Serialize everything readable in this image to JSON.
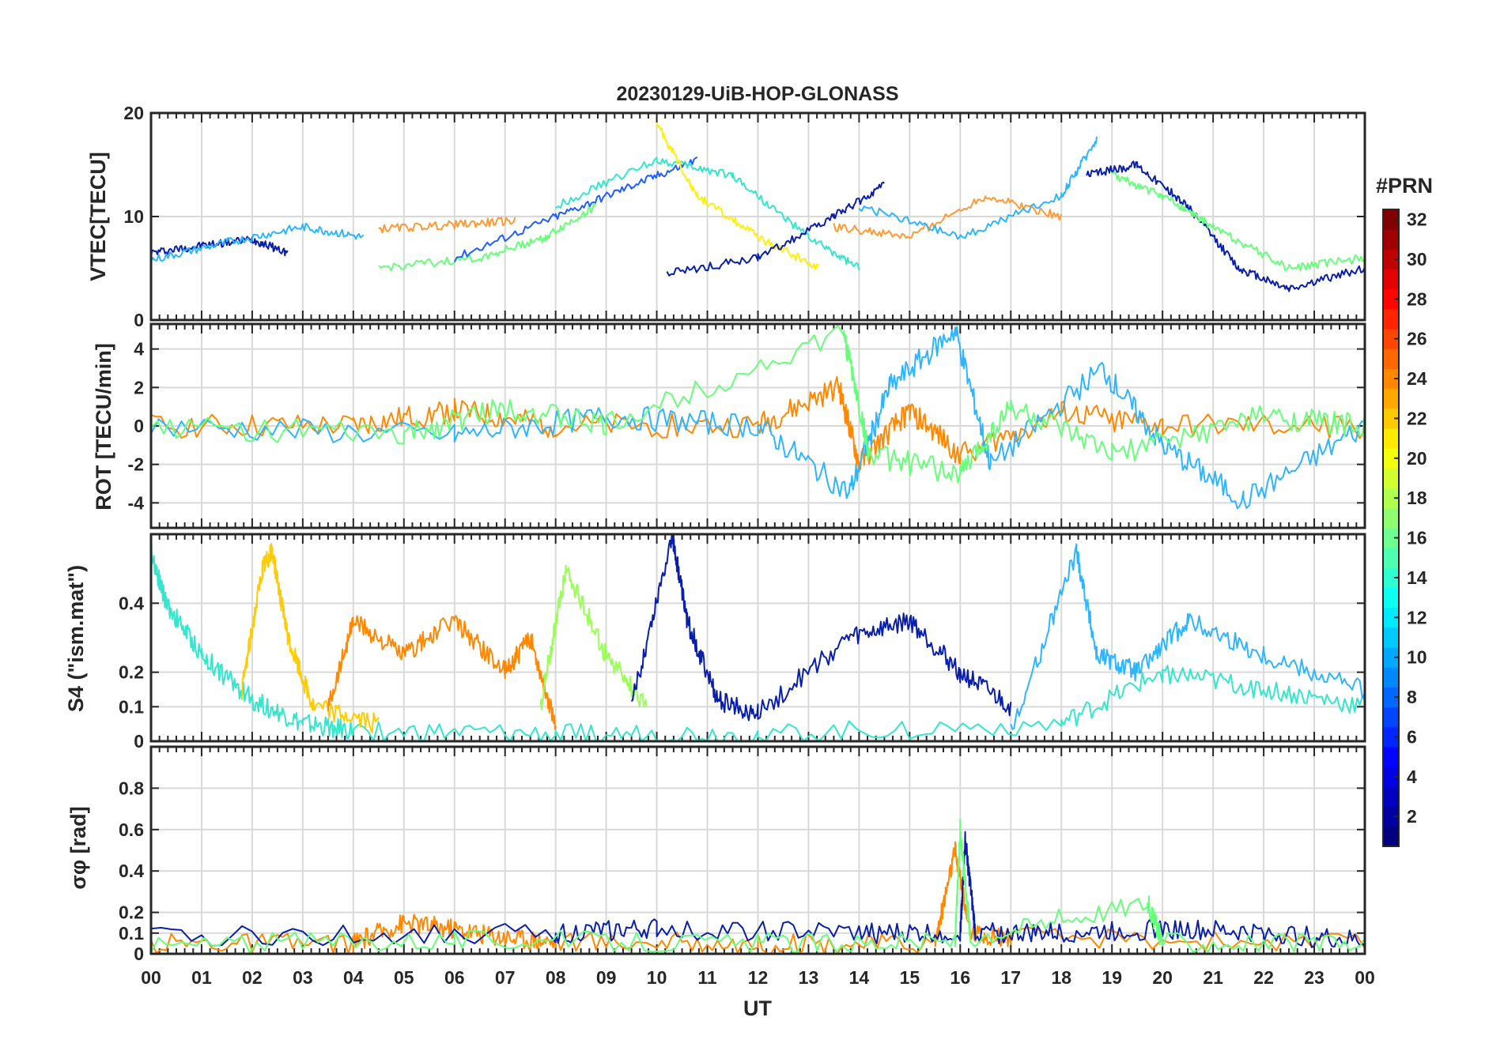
{
  "chart_data": [
    {
      "type": "line",
      "panel": "vtec",
      "title": "20230129-UiB-HOP-GLONASS",
      "ylabel": "VTEC[TECU]",
      "ylim": [
        0,
        20
      ],
      "yticks": [
        0,
        10,
        20
      ],
      "xlim": [
        0,
        24
      ],
      "grid": true,
      "series": [
        {
          "color": "#0a1fa8",
          "x": [
            0,
            1,
            2,
            2.7
          ],
          "y": [
            6.5,
            7.2,
            7.8,
            6.5
          ]
        },
        {
          "color": "#2db5ff",
          "x": [
            0,
            1.5,
            3,
            4.2
          ],
          "y": [
            5.8,
            7.5,
            9,
            8
          ]
        },
        {
          "color": "#ff9933",
          "x": [
            4.5,
            6,
            7.2
          ],
          "y": [
            8.8,
            9.2,
            9.6
          ]
        },
        {
          "color": "#66ff7a",
          "x": [
            4.5,
            6.5,
            7.8,
            8.8
          ],
          "y": [
            5,
            6,
            8,
            11
          ]
        },
        {
          "color": "#1f5fff",
          "x": [
            6,
            8,
            9.5,
            10.8
          ],
          "y": [
            6,
            10,
            13,
            15.5
          ]
        },
        {
          "color": "#33e6cc",
          "x": [
            8,
            10,
            11.5,
            13,
            14
          ],
          "y": [
            11,
            15.5,
            14,
            8,
            5
          ]
        },
        {
          "color": "#ffee11",
          "x": [
            10,
            10.8,
            12,
            13.2
          ],
          "y": [
            19,
            12,
            8,
            5
          ]
        },
        {
          "color": "#0a1fa8",
          "x": [
            10.2,
            12,
            13.5,
            14.5
          ],
          "y": [
            4.5,
            6,
            10,
            13
          ]
        },
        {
          "color": "#ff9933",
          "x": [
            13.5,
            15,
            16.5,
            18
          ],
          "y": [
            9,
            8,
            12,
            10
          ]
        },
        {
          "color": "#2db5ff",
          "x": [
            14,
            16,
            18,
            18.7
          ],
          "y": [
            11,
            8,
            12,
            17.5
          ]
        },
        {
          "color": "#0a1fa8",
          "x": [
            18.5,
            19.5,
            20.5,
            21.5,
            22.5,
            24
          ],
          "y": [
            14,
            15,
            11,
            5,
            3,
            5
          ]
        },
        {
          "color": "#66ff7a",
          "x": [
            19,
            20,
            21,
            22.5,
            24
          ],
          "y": [
            14,
            12,
            9,
            5,
            6
          ]
        }
      ]
    },
    {
      "type": "line",
      "panel": "rot",
      "ylabel": "ROT [TECU/min]",
      "ylim": [
        -5.3,
        5.3
      ],
      "yticks": [
        -4,
        -2,
        0,
        2,
        4
      ],
      "xlim": [
        0,
        24
      ],
      "grid": true,
      "series": [
        {
          "color": "#ff8800",
          "x": [
            0,
            4,
            6,
            8,
            12,
            13.6,
            14,
            15,
            16,
            18,
            20,
            24
          ],
          "y": [
            0,
            0,
            0.8,
            0,
            0,
            2,
            -2,
            0.8,
            -1.5,
            0.7,
            0,
            0
          ]
        },
        {
          "color": "#2db5ff",
          "x": [
            0,
            6,
            9,
            12,
            13.8,
            14.6,
            15.9,
            16.6,
            18.8,
            20,
            21.6,
            24
          ],
          "y": [
            0,
            -0.5,
            0.5,
            0,
            -3.5,
            2,
            5,
            -2,
            3,
            -1,
            -3.9,
            0
          ]
        },
        {
          "color": "#66ff7a",
          "x": [
            0,
            5,
            7,
            9,
            13.7,
            14.2,
            16,
            17,
            19,
            22,
            24
          ],
          "y": [
            0,
            -0.5,
            1,
            0,
            4.8,
            -1.5,
            -2.5,
            1,
            -1.5,
            0.5,
            0
          ]
        }
      ]
    },
    {
      "type": "line",
      "panel": "s4",
      "ylabel": "S4 (\"ism.mat\")",
      "ylim": [
        0,
        0.6
      ],
      "yticks": [
        0,
        0.1,
        0.2,
        0.4
      ],
      "xlim": [
        0,
        24
      ],
      "grid": true,
      "series": [
        {
          "color": "#33e6cc",
          "x": [
            0,
            0.3,
            1,
            2,
            3,
            4,
            8,
            12,
            18,
            20,
            22,
            24
          ],
          "y": [
            0.55,
            0.4,
            0.25,
            0.12,
            0.05,
            0.03,
            0.02,
            0.02,
            0.05,
            0.2,
            0.15,
            0.1
          ]
        },
        {
          "color": "#ffcc00",
          "x": [
            1.8,
            2.2,
            2.4,
            2.7,
            3.2,
            4.5
          ],
          "y": [
            0.15,
            0.5,
            0.55,
            0.3,
            0.1,
            0.05
          ]
        },
        {
          "color": "#ff8800",
          "x": [
            3.5,
            4,
            5,
            6,
            7,
            7.5,
            8
          ],
          "y": [
            0.1,
            0.35,
            0.25,
            0.35,
            0.2,
            0.3,
            0.05
          ]
        },
        {
          "color": "#99ff55",
          "x": [
            7.7,
            8.2,
            9,
            9.8
          ],
          "y": [
            0.1,
            0.5,
            0.25,
            0.1
          ]
        },
        {
          "color": "#0a1fa8",
          "x": [
            9.5,
            10.3,
            10.6,
            11.2,
            12,
            13.8,
            15,
            16,
            17
          ],
          "y": [
            0.1,
            0.6,
            0.35,
            0.12,
            0.08,
            0.3,
            0.35,
            0.2,
            0.1
          ]
        },
        {
          "color": "#2db5ff",
          "x": [
            17,
            18.3,
            18.7,
            19.5,
            20.5,
            22,
            24
          ],
          "y": [
            0.02,
            0.55,
            0.25,
            0.2,
            0.35,
            0.25,
            0.15
          ]
        }
      ]
    },
    {
      "type": "line",
      "panel": "sigma_phi",
      "ylabel": "σφ [rad]",
      "ylim": [
        0,
        1.0
      ],
      "yticks": [
        0,
        0.1,
        0.2,
        0.4,
        0.6,
        0.8
      ],
      "xlim": [
        0,
        24
      ],
      "grid": true,
      "series": [
        {
          "color": "#ff8800",
          "x": [
            0,
            4,
            5,
            6,
            7,
            8,
            12,
            15.5,
            15.9,
            16.2,
            17,
            24
          ],
          "y": [
            0.05,
            0.05,
            0.15,
            0.12,
            0.08,
            0.06,
            0.05,
            0.05,
            0.5,
            0.1,
            0.08,
            0.05
          ]
        },
        {
          "color": "#0a1fa8",
          "x": [
            0,
            8,
            10,
            14,
            16,
            16.1,
            16.3,
            18,
            20,
            22,
            24
          ],
          "y": [
            0.08,
            0.1,
            0.12,
            0.1,
            0.1,
            0.55,
            0.1,
            0.1,
            0.12,
            0.1,
            0.06
          ]
        },
        {
          "color": "#66ff7a",
          "x": [
            0,
            6,
            12,
            15.9,
            16,
            16.2,
            19.7,
            20,
            24
          ],
          "y": [
            0.04,
            0.07,
            0.05,
            0.06,
            0.6,
            0.08,
            0.25,
            0.06,
            0.04
          ]
        }
      ]
    }
  ],
  "xaxis": {
    "label": "UT",
    "ticks": [
      "00",
      "01",
      "02",
      "03",
      "04",
      "05",
      "06",
      "07",
      "08",
      "09",
      "10",
      "11",
      "12",
      "13",
      "14",
      "15",
      "16",
      "17",
      "18",
      "19",
      "20",
      "21",
      "22",
      "23",
      "00"
    ]
  },
  "colorbar": {
    "label": "#PRN",
    "range": [
      1,
      32
    ],
    "ticks": [
      2,
      4,
      6,
      8,
      10,
      12,
      14,
      16,
      18,
      20,
      22,
      24,
      26,
      28,
      30,
      32
    ],
    "colormap": "jet"
  }
}
